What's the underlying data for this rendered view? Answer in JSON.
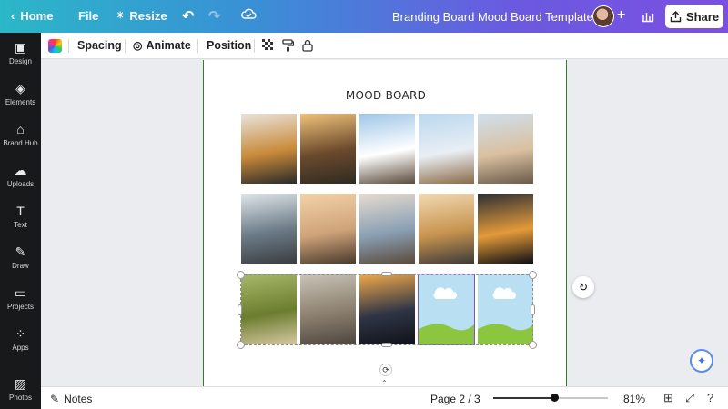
{
  "topbar": {
    "home_label": "Home",
    "file_label": "File",
    "resize_label": "Resize",
    "doc_title": "Branding Board Mood Board Template",
    "share_label": "Share"
  },
  "sidebar": {
    "items": [
      {
        "label": "Design",
        "icon": "design-icon"
      },
      {
        "label": "Elements",
        "icon": "elements-icon"
      },
      {
        "label": "Brand Hub",
        "icon": "brand-hub-icon"
      },
      {
        "label": "Uploads",
        "icon": "uploads-icon"
      },
      {
        "label": "Text",
        "icon": "text-icon"
      },
      {
        "label": "Draw",
        "icon": "draw-icon"
      },
      {
        "label": "Projects",
        "icon": "projects-icon"
      },
      {
        "label": "Apps",
        "icon": "apps-icon"
      },
      {
        "label": "Photos",
        "icon": "photos-icon"
      }
    ]
  },
  "context_toolbar": {
    "spacing_label": "Spacing",
    "animate_label": "Animate",
    "position_label": "Position"
  },
  "canvas": {
    "board_title": "MOOD BOARD",
    "photos": [
      {
        "name": "photo-flatlay-camera",
        "colors": [
          "#e9e4dc",
          "#c98a3a",
          "#2a2a2a"
        ]
      },
      {
        "name": "photo-palm-pier",
        "colors": [
          "#f0c27a",
          "#6b4a2c",
          "#2f2a22"
        ]
      },
      {
        "name": "photo-mountain-traveler",
        "colors": [
          "#9fc6e8",
          "#ffffff",
          "#5b4b3c"
        ]
      },
      {
        "name": "photo-signpost",
        "colors": [
          "#bcd8ef",
          "#e8eef4",
          "#8b6a45"
        ]
      },
      {
        "name": "photo-desert-van",
        "colors": [
          "#cfe0ee",
          "#d9c0a0",
          "#6a5a4a"
        ]
      },
      {
        "name": "photo-airplane-window-city",
        "colors": [
          "#dfe6ea",
          "#6b7a86",
          "#3a3d40"
        ]
      },
      {
        "name": "photo-beach-arms-up",
        "colors": [
          "#f3d2a8",
          "#cfa37a",
          "#4a3a2c"
        ]
      },
      {
        "name": "photo-backpack-traveler",
        "colors": [
          "#e6dbcf",
          "#8aa0b4",
          "#5a4a3c"
        ]
      },
      {
        "name": "photo-balloons-field",
        "colors": [
          "#f2d9b3",
          "#c7944f",
          "#3d3a38"
        ]
      },
      {
        "name": "photo-airplane-window-nyc",
        "colors": [
          "#2c2f35",
          "#e39a3a",
          "#0e1014"
        ]
      },
      {
        "name": "photo-green-hills",
        "colors": [
          "#a8b86a",
          "#6b7d2e",
          "#d6c7a3"
        ]
      },
      {
        "name": "photo-misty-road",
        "colors": [
          "#c9c3b6",
          "#8b7f6e",
          "#4d463e"
        ]
      },
      {
        "name": "photo-sunset-silhouette",
        "colors": [
          "#f0a84a",
          "#2f3546",
          "#101218"
        ]
      },
      {
        "name": "placeholder-landscape-1",
        "colors": [
          "#b8e0f2",
          "#ffffff",
          "#8cc63f"
        ]
      },
      {
        "name": "placeholder-landscape-2",
        "colors": [
          "#b8e0f2",
          "#ffffff",
          "#8cc63f"
        ]
      }
    ]
  },
  "bottombar": {
    "notes_label": "Notes",
    "page_label": "Page 2 / 3",
    "zoom_label": "81%",
    "zoom_fraction": 0.53
  },
  "colors": {
    "page_border": "#2f7d2f",
    "selection": "#7d4fe0",
    "sidebar_bg": "#18191b"
  }
}
